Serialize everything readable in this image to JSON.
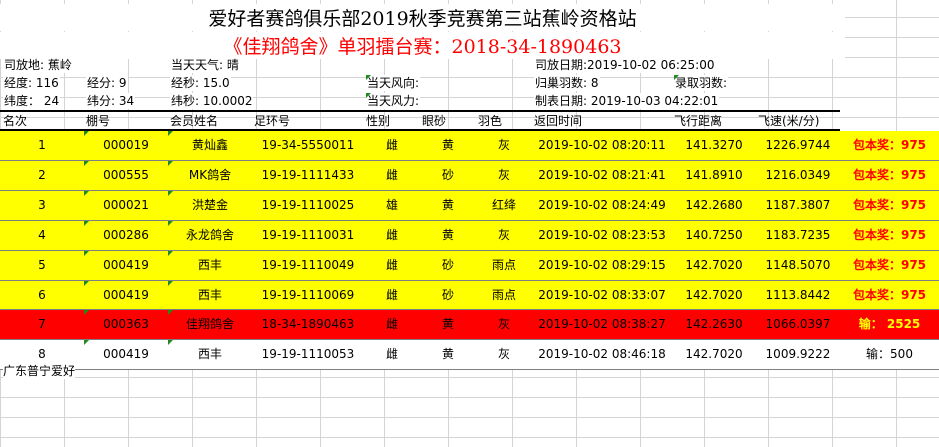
{
  "title": "爱好者赛鸽俱乐部2019秋季竞赛第三站蕉岭资格站",
  "subtitle": "《佳翔鸽舍》单羽擂台赛：2018-34-1890463",
  "meta": {
    "release_place": "司放地: 蕉岭",
    "weather": "当天天气: 晴",
    "release_date": "司放日期:2019-10-02 06:25:00",
    "longitude": "经度: 116",
    "lng_min": "经分: 9",
    "lng_sec": "经秒: 15.0",
    "wind_dir": "当天风向:",
    "returned": "归巢羽数: 8",
    "recorded": "录取羽数:",
    "latitude": "纬度： 24",
    "lat_min": "纬分: 34",
    "lat_sec": "纬秒: 10.0002",
    "wind_force": "当天风力:",
    "made_date": "制表日期: 2019-10-03 04:22:01"
  },
  "headers": {
    "rank": "名次",
    "shed": "棚号",
    "member": "会员姓名",
    "ring": "足环号",
    "sex": "性别",
    "eye": "眼砂",
    "color": "羽色",
    "return_time": "返回时间",
    "distance": "飞行距离",
    "speed": "飞速(米/分)"
  },
  "rows": [
    {
      "rank": "1",
      "shed": "000019",
      "member": "黄灿鑫",
      "ring": "19-34-5550011",
      "sex": "雌",
      "eye": "黄",
      "color": "灰",
      "return_time": "2019-10-02 08:20:11",
      "distance": "141.3270",
      "speed": "1226.9744",
      "prize": "包本奖：975"
    },
    {
      "rank": "2",
      "shed": "000555",
      "member": "MK鸽舍",
      "ring": "19-19-1111433",
      "sex": "雌",
      "eye": "砂",
      "color": "灰",
      "return_time": "2019-10-02 08:21:41",
      "distance": "141.8910",
      "speed": "1216.0349",
      "prize": "包本奖：975"
    },
    {
      "rank": "3",
      "shed": "000021",
      "member": "洪楚金",
      "ring": "19-19-1110025",
      "sex": "雄",
      "eye": "黄",
      "color": "红绛",
      "return_time": "2019-10-02 08:24:49",
      "distance": "142.2680",
      "speed": "1187.3807",
      "prize": "包本奖：975"
    },
    {
      "rank": "4",
      "shed": "000286",
      "member": "永龙鸽舍",
      "ring": "19-19-1110031",
      "sex": "雌",
      "eye": "黄",
      "color": "灰",
      "return_time": "2019-10-02 08:23:53",
      "distance": "140.7250",
      "speed": "1183.7235",
      "prize": "包本奖：975"
    },
    {
      "rank": "5",
      "shed": "000419",
      "member": "西丰",
      "ring": "19-19-1110049",
      "sex": "雌",
      "eye": "砂",
      "color": "雨点",
      "return_time": "2019-10-02 08:29:15",
      "distance": "142.7020",
      "speed": "1148.5070",
      "prize": "包本奖：975"
    },
    {
      "rank": "6",
      "shed": "000419",
      "member": "西丰",
      "ring": "19-19-1110069",
      "sex": "雌",
      "eye": "砂",
      "color": "雨点",
      "return_time": "2019-10-02 08:33:07",
      "distance": "142.7020",
      "speed": "1113.8442",
      "prize": "包本奖：975"
    },
    {
      "rank": "7",
      "shed": "000363",
      "member": "佳翔鸽舍",
      "ring": "18-34-1890463",
      "sex": "雌",
      "eye": "黄",
      "color": "灰",
      "return_time": "2019-10-02 08:38:27",
      "distance": "142.2630",
      "speed": "1066.0397",
      "prize": "输： 2525"
    },
    {
      "rank": "8",
      "shed": "000419",
      "member": "西丰",
      "ring": "19-19-1110053",
      "sex": "雌",
      "eye": "黄",
      "color": "灰",
      "return_time": "2019-10-02 08:46:18",
      "distance": "142.7020",
      "speed": "1009.9222",
      "prize": "输：500"
    }
  ],
  "footer": "广东普宁爱好",
  "colors": {
    "highlight_yellow": "#ffff00",
    "highlight_red": "#ff0000",
    "prize_red": "#ff0000",
    "grid": "#d4d4d4"
  }
}
